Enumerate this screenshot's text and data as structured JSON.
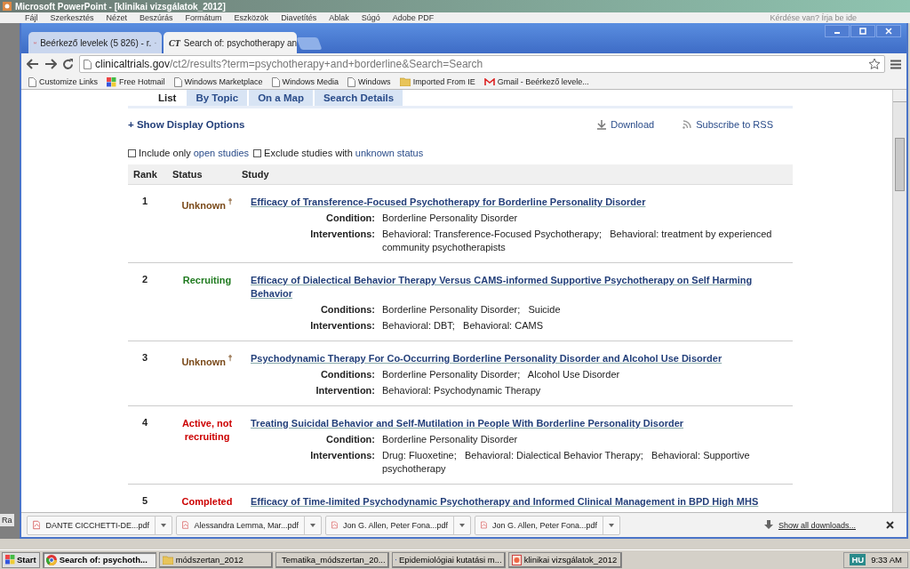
{
  "ppt": {
    "title": "Microsoft PowerPoint - [klinikai vizsgálatok_2012]",
    "menu": [
      "Fájl",
      "Szerkesztés",
      "Nézet",
      "Beszúrás",
      "Formátum",
      "Eszközök",
      "Diavetítés",
      "Ablak",
      "Súgó",
      "Adobe PDF"
    ],
    "help_placeholder": "Kérdése van? Írja be ide",
    "side_label": "Ra"
  },
  "browser": {
    "tabs": [
      {
        "kind": "gmail",
        "label": "Beérkező levelek (5 826) - r.",
        "selected": false
      },
      {
        "kind": "ct",
        "label": "Search of: psychotherapy an",
        "prefix": "CT",
        "selected": true
      }
    ],
    "url_host": "clinicaltrials.gov",
    "url_path": "/ct2/results?term=psychotherapy+and+borderline&Search=Search",
    "bookmarks": [
      {
        "kind": "page",
        "label": "Customize Links"
      },
      {
        "kind": "windows",
        "label": "Free Hotmail"
      },
      {
        "kind": "page",
        "label": "Windows Marketplace"
      },
      {
        "kind": "page",
        "label": "Windows Media"
      },
      {
        "kind": "page",
        "label": "Windows"
      },
      {
        "kind": "folder",
        "label": "Imported From IE"
      },
      {
        "kind": "gmail",
        "label": "Gmail - Beérkező levele..."
      }
    ]
  },
  "page": {
    "tabs": [
      {
        "label": "List",
        "selected": true
      },
      {
        "label": "By Topic",
        "selected": false
      },
      {
        "label": "On a Map",
        "selected": false
      },
      {
        "label": "Search Details",
        "selected": false
      }
    ],
    "display_options": "+ Show Display Options",
    "download": "Download",
    "rss": "Subscribe to RSS",
    "filters": [
      {
        "text": "Include only ",
        "link": "open studies",
        "checked": false
      },
      {
        "text": "Exclude studies with ",
        "link": "unknown status",
        "checked": false
      }
    ],
    "columns": [
      "Rank",
      "Status",
      "Study"
    ],
    "rows": [
      {
        "rank": "1",
        "status": "Unknown",
        "color": "#7a4a1a",
        "mark": "†",
        "title": "Efficacy of Transference-Focused Psychotherapy for Borderline Personality Disorder",
        "details": [
          {
            "label": "Condition:",
            "value": "Borderline Personality Disorder"
          },
          {
            "label": "Interventions:",
            "value": "Behavioral: Transference-Focused Psychotherapy;   Behavioral: treatment by experienced community psychotherapists"
          }
        ]
      },
      {
        "rank": "2",
        "status": "Recruiting",
        "color": "#1f7a1f",
        "title": "Efficacy of Dialectical Behavior Therapy Versus CAMS-informed Supportive Psychotherapy on Self Harming Behavior",
        "details": [
          {
            "label": "Conditions:",
            "value": "Borderline Personality Disorder;   Suicide"
          },
          {
            "label": "Interventions:",
            "value": "Behavioral: DBT;   Behavioral: CAMS"
          }
        ]
      },
      {
        "rank": "3",
        "status": "Unknown",
        "color": "#7a4a1a",
        "mark": "†",
        "title": "Psychodynamic Therapy For Co-Occurring Borderline Personality Disorder and Alcohol Use Disorder",
        "details": [
          {
            "label": "Conditions:",
            "value": "Borderline Personality Disorder;   Alcohol Use Disorder"
          },
          {
            "label": "Intervention:",
            "value": "Behavioral: Psychodynamic Therapy"
          }
        ]
      },
      {
        "rank": "4",
        "status": "Active, not recruiting",
        "color": "#cc0000",
        "title": "Treating Suicidal Behavior and Self-Mutilation in People With Borderline Personality Disorder",
        "details": [
          {
            "label": "Condition:",
            "value": "Borderline Personality Disorder"
          },
          {
            "label": "Interventions:",
            "value": "Drug: Fluoxetine;   Behavioral: Dialectical Behavior Therapy;   Behavioral: Supportive psychotherapy"
          }
        ]
      },
      {
        "rank": "5",
        "status": "Completed",
        "color": "#cc0000",
        "title": "Efficacy of Time-limited Psychodynamic Psychotherapy and Informed Clinical Management in BPD High MHS"
      }
    ]
  },
  "downloads": {
    "items": [
      "DANTE CICCHETTI-DE...pdf",
      "Alessandra Lemma, Mar...pdf",
      "Jon G. Allen, Peter Fona...pdf",
      "Jon G. Allen, Peter Fona...pdf"
    ],
    "show_all": "Show all downloads..."
  },
  "taskbar": {
    "start": "Start",
    "items": [
      {
        "kind": "chrome",
        "label": "Search of: psychoth...",
        "selected": true
      },
      {
        "kind": "folder",
        "label": "módszertan_2012",
        "selected": false
      },
      {
        "kind": "doc",
        "label": "Tematika_módszertan_20...",
        "selected": false
      },
      {
        "kind": "doc",
        "label": "Epidemiológiai kutatási m...",
        "selected": false
      },
      {
        "kind": "ppt",
        "label": "klinikai vizsgálatok_2012",
        "selected": false
      }
    ],
    "language": "HU",
    "clock": "9:33 AM"
  }
}
